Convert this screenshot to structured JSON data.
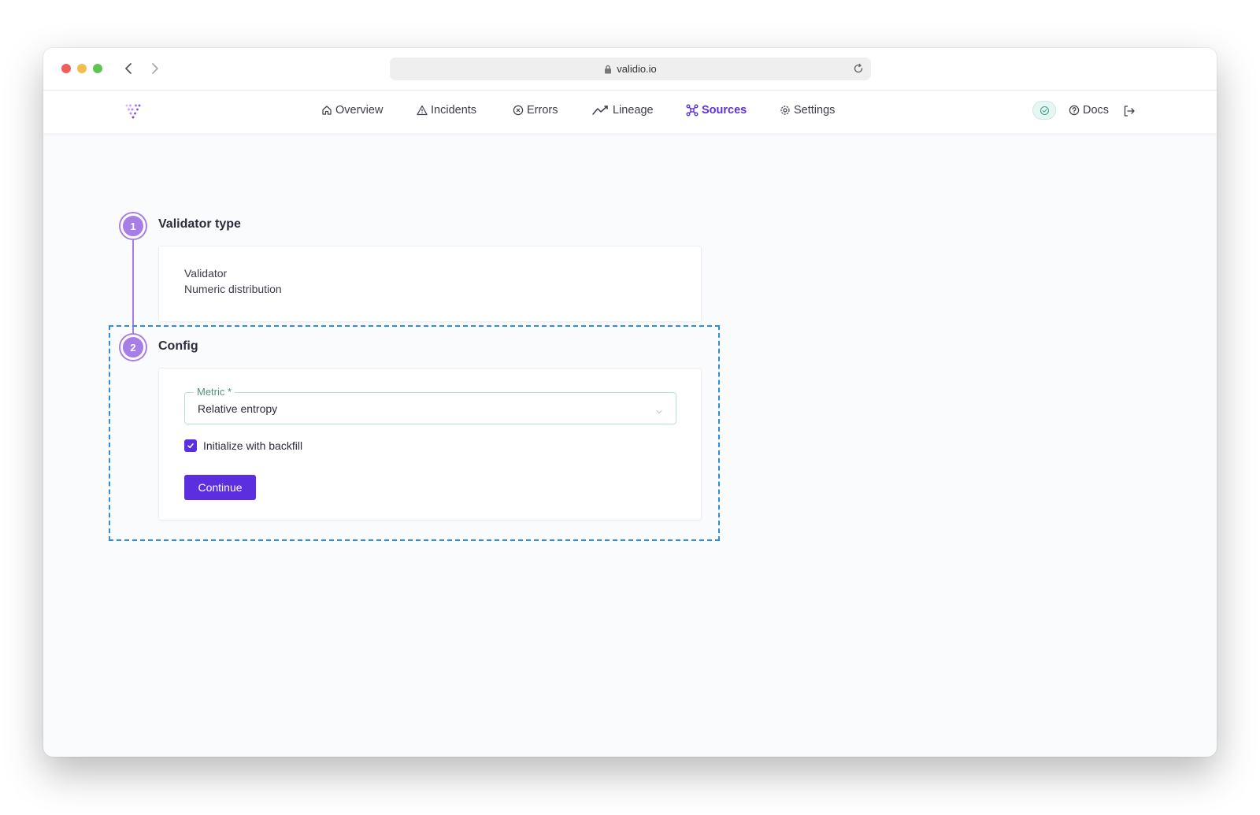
{
  "browser": {
    "url": "validio.io",
    "icons": {
      "back": "chevron-left-icon",
      "forward": "chevron-right-icon",
      "lock": "lock-icon",
      "reload": "reload-icon"
    }
  },
  "nav": {
    "items": [
      {
        "label": "Overview",
        "icon": "home-icon"
      },
      {
        "label": "Incidents",
        "icon": "warning-triangle-icon"
      },
      {
        "label": "Errors",
        "icon": "x-circle-icon"
      },
      {
        "label": "Lineage",
        "icon": "line-chart-icon"
      },
      {
        "label": "Sources",
        "icon": "nodes-icon",
        "active": true
      },
      {
        "label": "Settings",
        "icon": "gear-icon"
      }
    ],
    "docs": "Docs",
    "accent_color": "#5b2ee0"
  },
  "steps": [
    {
      "number": "1",
      "title": "Validator type"
    },
    {
      "number": "2",
      "title": "Config"
    }
  ],
  "validator_card": {
    "label": "Validator",
    "value": "Numeric distribution"
  },
  "config": {
    "metric_label": "Metric *",
    "metric_value": "Relative entropy",
    "backfill_checked": true,
    "backfill_label": "Initialize with backfill",
    "continue_label": "Continue"
  }
}
